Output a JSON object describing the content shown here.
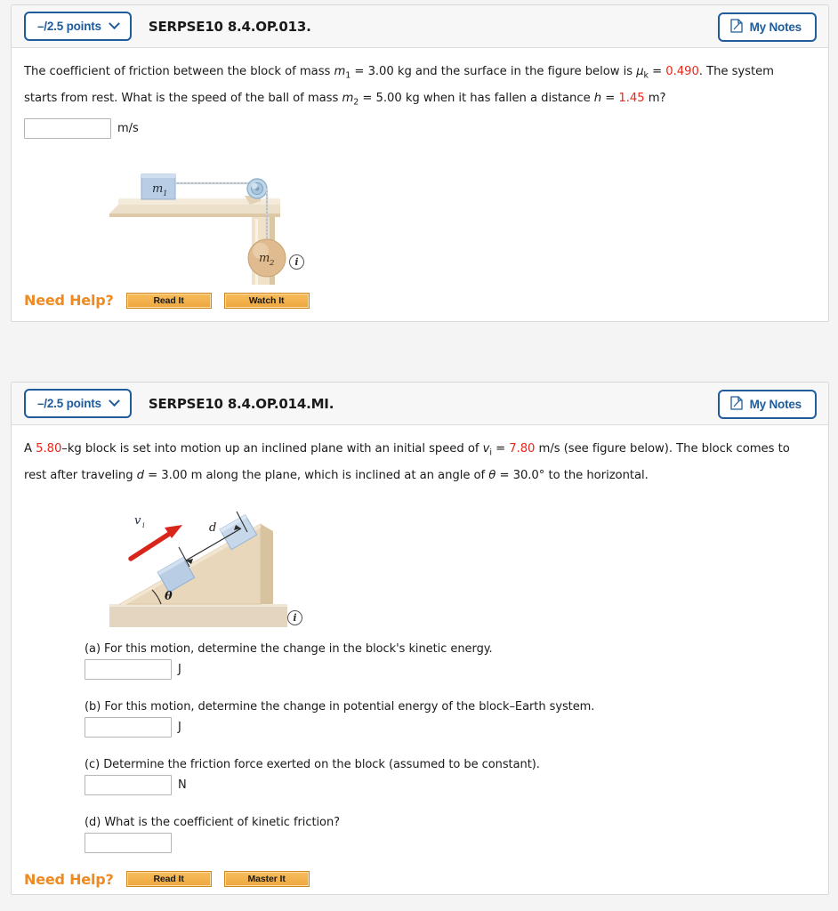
{
  "questions": [
    {
      "points_label": "–/2.5 points",
      "title": "SERPSE10 8.4.OP.013.",
      "notes_label": "My Notes",
      "notes_icon": "note-page-icon",
      "chevron_icon": "chevron-down-icon",
      "body": {
        "text_1": "The coefficient of friction between the block of mass ",
        "var_m1": "m",
        "sub_1": "1",
        "text_2": " = 3.00 kg and the surface in the figure below is ",
        "var_mu": "μ",
        "sub_k": "k",
        "text_3": " = ",
        "val_mu": "0.490",
        "text_4": ". The system starts from rest. What is the speed of the ball of mass ",
        "var_m2": "m",
        "sub_2": "2",
        "text_5": " = 5.00 kg when it has fallen a distance ",
        "var_h": "h",
        "text_6": " = ",
        "val_h": "1.45",
        "text_7": " m?"
      },
      "answer": {
        "value": "",
        "placeholder": "",
        "unit": "m/s"
      },
      "figure": {
        "name": "block-pulley-ball-figure",
        "label_m1": "m",
        "label_m1_sub": "1",
        "label_m2": "m",
        "label_m2_sub": "2",
        "info_icon": "info-circle-icon"
      },
      "need_help": {
        "label": "Need Help?",
        "buttons": [
          "Read It",
          "Watch It"
        ]
      }
    },
    {
      "points_label": "–/2.5 points",
      "title": "SERPSE10 8.4.OP.014.MI.",
      "notes_label": "My Notes",
      "notes_icon": "note-page-icon",
      "chevron_icon": "chevron-down-icon",
      "body": {
        "text_1": "A ",
        "val_mass": "5.80",
        "text_2": "–kg block is set into motion up an inclined plane with an initial speed of ",
        "var_v": "v",
        "sub_i": "i",
        "text_3": " = ",
        "val_v": "7.80",
        "text_4": " m/s (see figure below). The block comes to rest after traveling ",
        "var_d": "d",
        "text_5": " = 3.00 m along the plane, which is inclined at an angle of ",
        "var_theta": "θ",
        "text_6": " = 30.0° to the horizontal."
      },
      "figure": {
        "name": "inclined-plane-figure",
        "label_vi": "v",
        "label_vi_sub": "i",
        "label_d": "d",
        "label_theta": "θ",
        "info_icon": "info-circle-icon"
      },
      "parts": [
        {
          "id": "a",
          "question": "(a) For this motion, determine the change in the block's kinetic energy.",
          "value": "",
          "unit": "J"
        },
        {
          "id": "b",
          "question": "(b) For this motion, determine the change in potential energy of the block–Earth system.",
          "value": "",
          "unit": "J"
        },
        {
          "id": "c",
          "question": "(c) Determine the friction force exerted on the block (assumed to be constant).",
          "value": "",
          "unit": "N"
        },
        {
          "id": "d",
          "question": "(d) What is the coefficient of kinetic friction?",
          "value": "",
          "unit": ""
        }
      ],
      "need_help": {
        "label": "Need Help?",
        "buttons": [
          "Read It",
          "Master It"
        ]
      }
    }
  ],
  "colors": {
    "accent_blue": "#1f5c99",
    "highlight_red": "#e8271a",
    "help_orange": "#ef8a22",
    "card_border": "#d9d9d9",
    "header_bg": "#f7f7f7"
  }
}
